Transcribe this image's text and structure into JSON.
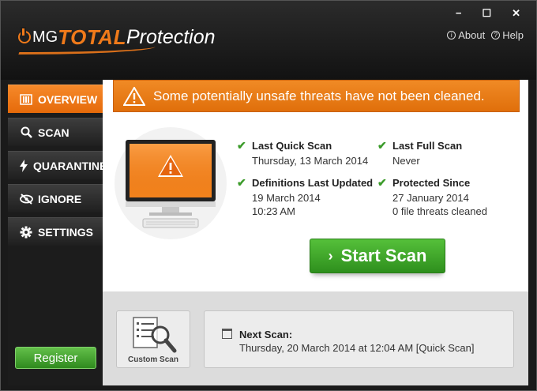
{
  "window": {
    "controls": {
      "minimize": "−",
      "maximize": "☐",
      "close": "✕"
    },
    "help_links": {
      "about": "About",
      "help": "Help"
    }
  },
  "logo": {
    "mg": "MG",
    "total": "TOTAL",
    "protection": "Protection"
  },
  "sidebar": {
    "items": [
      {
        "label": "OVERVIEW",
        "icon": "overview-icon",
        "active": true
      },
      {
        "label": "SCAN",
        "icon": "search-icon",
        "active": false
      },
      {
        "label": "QUARANTINE",
        "icon": "lightning-icon",
        "active": false
      },
      {
        "label": "IGNORE",
        "icon": "eye-slash-icon",
        "active": false
      },
      {
        "label": "SETTINGS",
        "icon": "gear-icon",
        "active": false
      }
    ],
    "register_label": "Register"
  },
  "alert": {
    "text": "Some potentially unsafe threats have not been cleaned."
  },
  "status": {
    "last_quick_scan": {
      "title": "Last Quick Scan",
      "value": "Thursday, 13 March 2014"
    },
    "last_full_scan": {
      "title": "Last Full Scan",
      "value": "Never"
    },
    "definitions": {
      "title": "Definitions Last Updated",
      "date": "19 March 2014",
      "time": "10:23 AM"
    },
    "protected_since": {
      "title": "Protected Since",
      "date": "27 January 2014",
      "threats": "0 file threats cleaned"
    }
  },
  "start_scan_label": "Start Scan",
  "custom_scan_label": "Custom Scan",
  "next_scan": {
    "title": "Next Scan:",
    "value": "Thursday, 20 March 2014 at 12:04 AM  [Quick Scan]"
  },
  "colors": {
    "accent": "#f07a1a",
    "success": "#3b9b2a",
    "start_button": "#3aa626"
  }
}
